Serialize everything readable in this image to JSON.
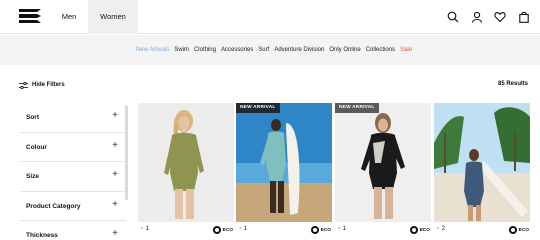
{
  "header": {
    "logo_icon": "billabong-logo-icon",
    "tabs": [
      {
        "label": "Men",
        "active": false
      },
      {
        "label": "Women",
        "active": true
      }
    ],
    "icons": [
      "search-icon",
      "account-icon",
      "wishlist-heart-icon",
      "bag-icon"
    ]
  },
  "category_nav": {
    "items": [
      {
        "label": "New Arrivals",
        "state": "active"
      },
      {
        "label": "Swim",
        "state": ""
      },
      {
        "label": "Clothing",
        "state": ""
      },
      {
        "label": "Accessories",
        "state": ""
      },
      {
        "label": "Surf",
        "state": ""
      },
      {
        "label": "Adventure Division",
        "state": ""
      },
      {
        "label": "Only Online",
        "state": ""
      },
      {
        "label": "Collections",
        "state": ""
      },
      {
        "label": "Sale",
        "state": "sale"
      }
    ],
    "active_color": "#7fa8d8",
    "sale_color": "#e8543a"
  },
  "toolbar": {
    "hide_filters_label": "Hide Filters",
    "results_label": "85 Results"
  },
  "filters": [
    {
      "label": "Sort"
    },
    {
      "label": "Colour"
    },
    {
      "label": "Size"
    },
    {
      "label": "Product Category"
    },
    {
      "label": "Thickness"
    }
  ],
  "products": [
    {
      "badge": "",
      "likes": "1",
      "eco_label": "ECO"
    },
    {
      "badge": "NEW ARRIVAL",
      "likes": "1",
      "eco_label": "ECO"
    },
    {
      "badge": "NEW ARRIVAL",
      "likes": "1",
      "eco_label": "ECO"
    },
    {
      "badge": "",
      "likes": "2",
      "eco_label": "ECO"
    }
  ]
}
